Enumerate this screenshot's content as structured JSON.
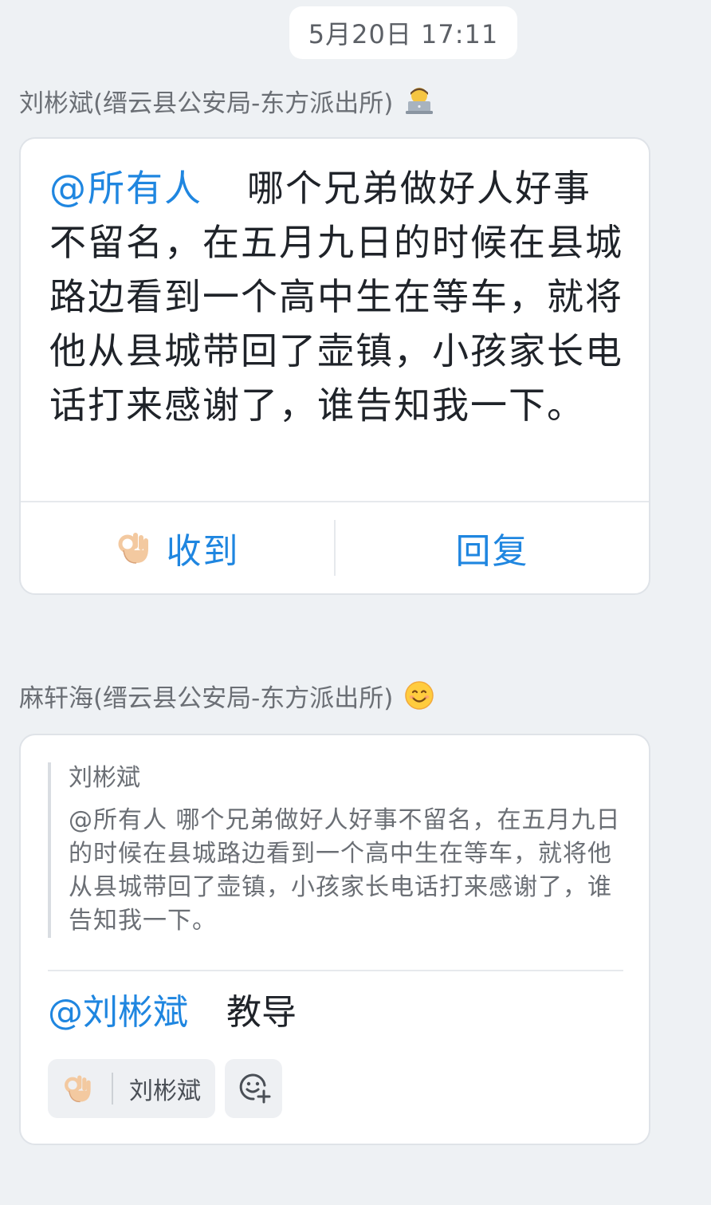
{
  "timestamp": "5月20日 17:11",
  "message1": {
    "sender": "刘彬斌(缙云县公安局-东方派出所)",
    "sender_emoji": "person-at-laptop-emoji",
    "mention": "@所有人",
    "text": "哪个兄弟做好人好事不留名，在五月九日的时候在县城路边看到一个高中生在等车，就将他从县城带回了壶镇，小孩家长电话打来感谢了，谁告知我一下。",
    "actions": {
      "ack_icon": "ok-hand-emoji",
      "ack_label": "收到",
      "reply_label": "回复"
    }
  },
  "message2": {
    "sender": "麻轩海(缙云县公安局-东方派出所)",
    "sender_emoji": "smiling-face-emoji",
    "quote": {
      "author": "刘彬斌",
      "text": "@所有人 哪个兄弟做好人好事不留名，在五月九日的时候在县城路边看到一个高中生在等车，就将他从县城带回了壶镇，小孩家长电话打来感谢了，谁告知我一下。"
    },
    "reply_mention": "@刘彬斌",
    "reply_text": "教导",
    "reactions": [
      {
        "icon": "ok-hand-emoji",
        "user": "刘彬斌"
      }
    ],
    "add_reaction_icon": "add-reaction-icon"
  },
  "colors": {
    "background": "#eef1f4",
    "accent": "#1f86e0",
    "card": "#ffffff",
    "muted_text": "#6b6f75"
  }
}
